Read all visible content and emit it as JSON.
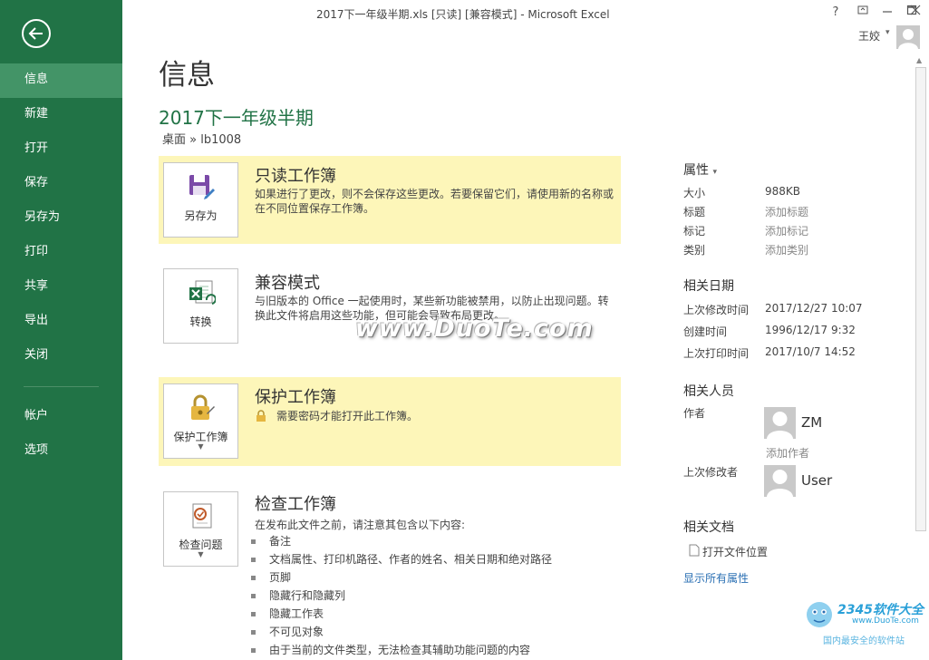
{
  "window": {
    "title": "2017下一年级半期.xls  [只读]  [兼容模式] - Microsoft Excel",
    "help": "?",
    "user_name": "王姣"
  },
  "sidebar": {
    "items": [
      {
        "label": "信息",
        "active": true
      },
      {
        "label": "新建"
      },
      {
        "label": "打开"
      },
      {
        "label": "保存"
      },
      {
        "label": "另存为"
      },
      {
        "label": "打印"
      },
      {
        "label": "共享"
      },
      {
        "label": "导出"
      },
      {
        "label": "关闭"
      }
    ],
    "bottom_items": [
      {
        "label": "帐户"
      },
      {
        "label": "选项"
      }
    ]
  },
  "main": {
    "page_title": "信息",
    "file_title": "2017下一年级半期",
    "breadcrumb": "桌面 » lb1008",
    "sections": [
      {
        "button_label": "另存为",
        "heading": "只读工作簿",
        "description": "如果进行了更改，则不会保存这些更改。若要保留它们，请使用新的名称或在不同位置保存工作簿。"
      },
      {
        "button_label": "转换",
        "heading": "兼容模式",
        "description": "与旧版本的 Office 一起使用时，某些新功能被禁用，以防止出现问题。转换此文件将启用这些功能，但可能会导致布局更改。"
      },
      {
        "button_label": "保护工作簿",
        "heading": "保护工作簿",
        "description": "需要密码才能打开此工作簿。"
      },
      {
        "button_label": "检查问题",
        "heading": "检查工作簿",
        "description": "在发布此文件之前，请注意其包含以下内容:",
        "bullets": [
          "备注",
          "文档属性、打印机路径、作者的姓名、相关日期和绝对路径",
          "页脚",
          "隐藏行和隐藏列",
          "隐藏工作表",
          "不可见对象",
          "由于当前的文件类型，无法检查其辅助功能问题的内容"
        ]
      }
    ]
  },
  "properties": {
    "header": "属性",
    "size_label": "大小",
    "size_value": "988KB",
    "title_label": "标题",
    "title_value": "添加标题",
    "tags_label": "标记",
    "tags_value": "添加标记",
    "category_label": "类别",
    "category_value": "添加类别",
    "dates_header": "相关日期",
    "modified_label": "上次修改时间",
    "modified_value": "2017/12/27 10:07",
    "created_label": "创建时间",
    "created_value": "1996/12/17 9:32",
    "printed_label": "上次打印时间",
    "printed_value": "2017/10/7 14:52",
    "people_header": "相关人员",
    "author_label": "作者",
    "author_name": "ZM",
    "add_author": "添加作者",
    "last_modified_by_label": "上次修改者",
    "last_modified_by_name": "User",
    "docs_header": "相关文档",
    "open_location": "打开文件位置",
    "show_all": "显示所有属性"
  },
  "watermarks": {
    "center": "www.DuoTe.com",
    "corner_brand": "2345软件大全",
    "corner_url": "www.DuoTe.com",
    "corner_tag": "国内最安全的软件站"
  },
  "colors": {
    "excel_green": "#217346",
    "sidebar_active": "#439467",
    "highlight": "#fdf6b9"
  }
}
